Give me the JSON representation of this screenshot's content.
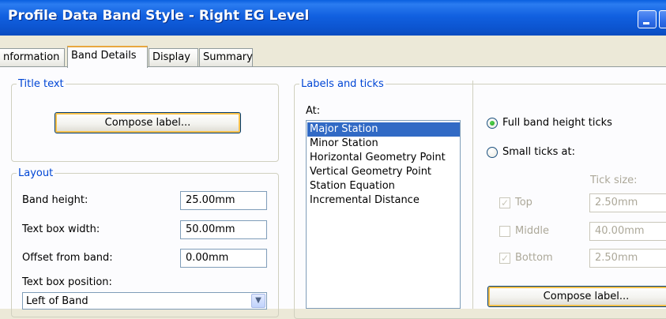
{
  "window": {
    "title": "Profile Data Band Style - Right EG Level"
  },
  "tabs": [
    {
      "label": "nformation"
    },
    {
      "label": "Band Details"
    },
    {
      "label": "Display"
    },
    {
      "label": "Summary"
    }
  ],
  "title_text": {
    "legend": "Title text",
    "compose_label": "Compose label..."
  },
  "layout": {
    "legend": "Layout",
    "band_height_label": "Band height:",
    "band_height_value": "25.00mm",
    "text_box_width_label": "Text box width:",
    "text_box_width_value": "50.00mm",
    "offset_label": "Offset from band:",
    "offset_value": "0.00mm",
    "position_label": "Text box position:",
    "position_value": "Left of Band"
  },
  "labels_ticks": {
    "legend": "Labels and ticks",
    "at_label": "At:",
    "items": [
      "Major Station",
      "Minor Station",
      "Horizontal Geometry Point",
      "Vertical Geometry Point",
      "Station Equation",
      "Incremental Distance"
    ],
    "selected_index": 0,
    "full_band_ticks": "Full band height ticks",
    "small_ticks": "Small ticks at:",
    "tick_size_label": "Tick size:",
    "top_label": "Top",
    "top_value": "2.50mm",
    "middle_label": "Middle",
    "middle_value": "40.00mm",
    "bottom_label": "Bottom",
    "bottom_value": "2.50mm",
    "compose_label": "Compose label..."
  },
  "colors": {
    "title_bar": "#0c54cf",
    "group_legend": "#0046d5",
    "selection": "#316ac5",
    "active_tab_accent": "#e8a73e"
  }
}
